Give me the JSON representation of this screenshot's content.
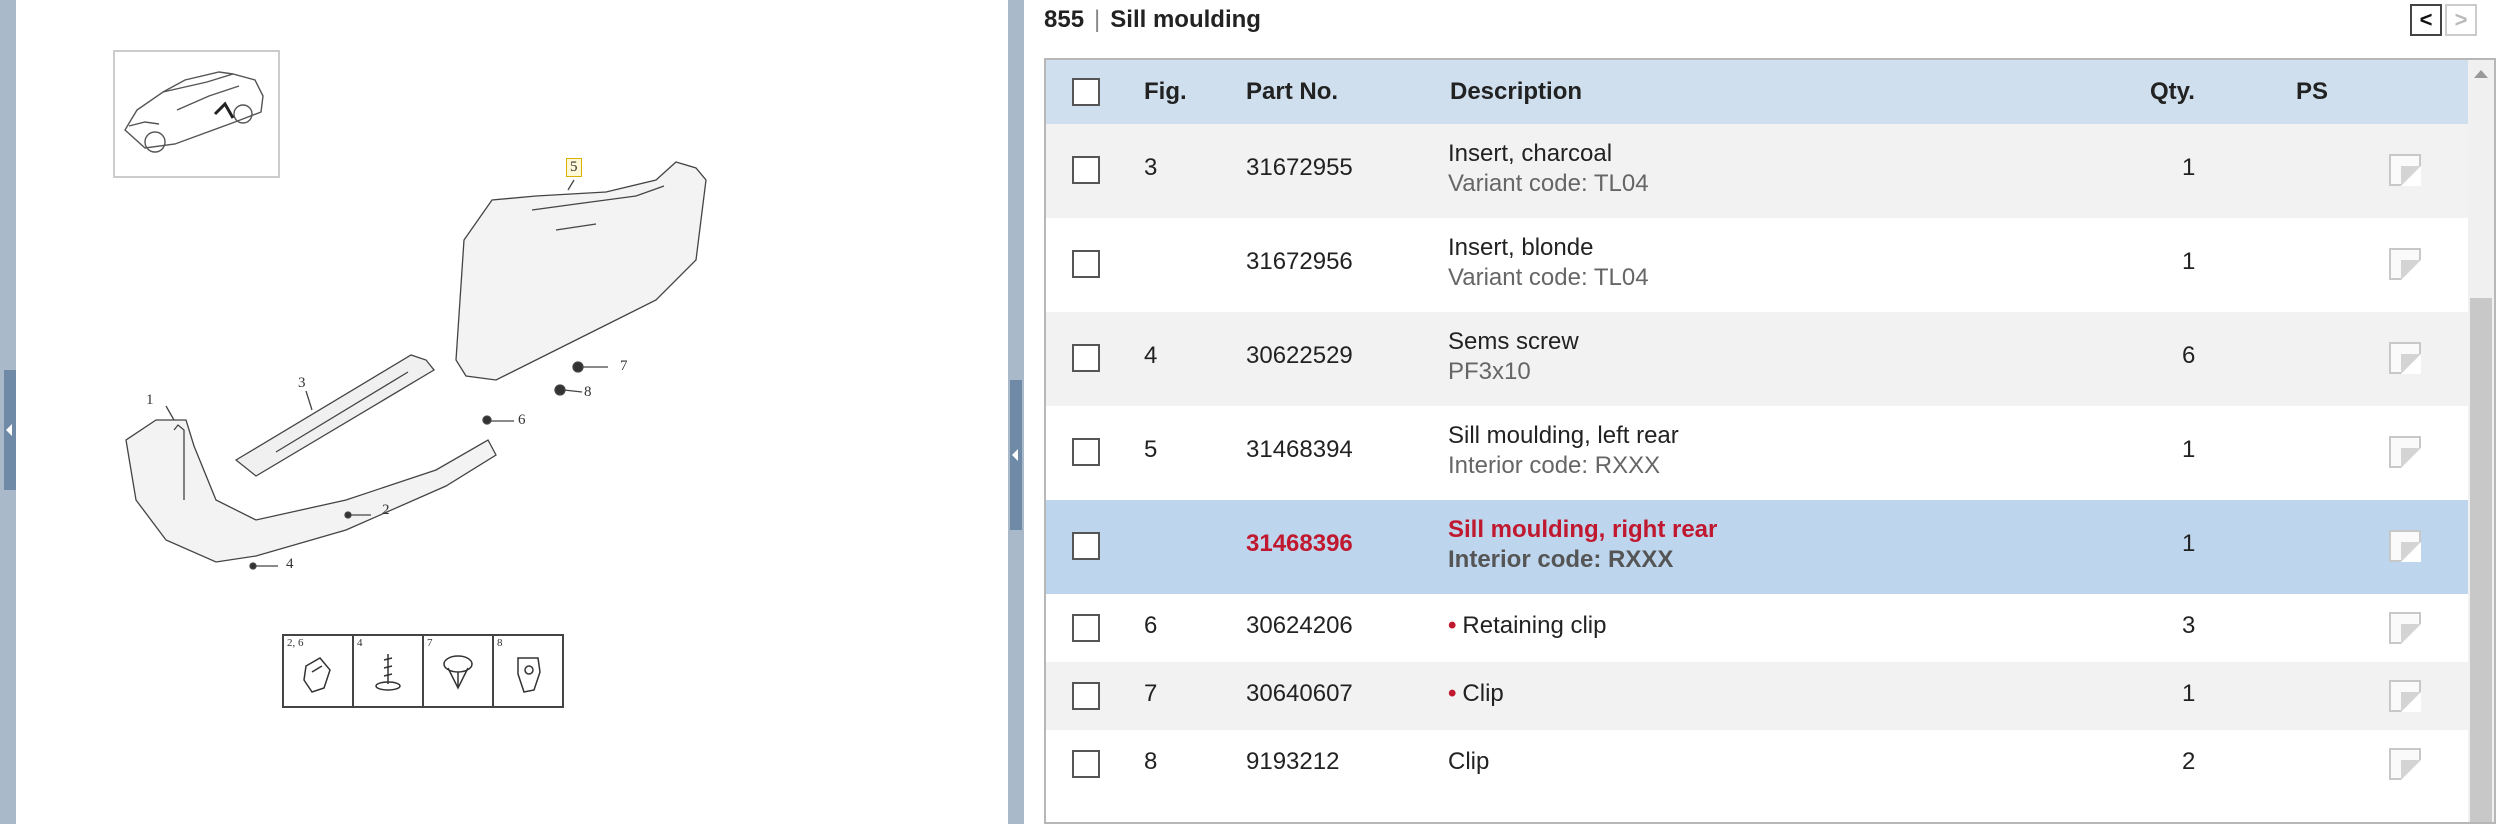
{
  "diagram": {
    "callouts": [
      "1",
      "2",
      "3",
      "4",
      "5",
      "6",
      "7",
      "8"
    ],
    "legend": [
      {
        "label": "2, 6"
      },
      {
        "label": "4"
      },
      {
        "label": "7"
      },
      {
        "label": "8"
      }
    ]
  },
  "header": {
    "group_number": "855",
    "separator": "|",
    "title": "Sill moulding"
  },
  "nav": {
    "prev_icon": "chevron-left-icon",
    "prev_glyph": "<",
    "next_icon": "chevron-right-icon",
    "next_glyph": ">"
  },
  "table": {
    "columns": {
      "fig": "Fig.",
      "part_no": "Part No.",
      "description": "Description",
      "qty": "Qty.",
      "ps": "PS"
    },
    "rows": [
      {
        "fig": "3",
        "part_no": "31672955",
        "description": "Insert, charcoal",
        "sub": "Variant code: TL04",
        "qty": "1",
        "bullet": ""
      },
      {
        "fig": "",
        "part_no": "31672956",
        "description": "Insert, blonde",
        "sub": "Variant code: TL04",
        "qty": "1",
        "bullet": ""
      },
      {
        "fig": "4",
        "part_no": "30622529",
        "description": "Sems screw",
        "sub": "PF3x10",
        "qty": "6",
        "bullet": ""
      },
      {
        "fig": "5",
        "part_no": "31468394",
        "description": "Sill moulding, left rear",
        "sub": "Interior code: RXXX",
        "qty": "1",
        "bullet": ""
      },
      {
        "fig": "",
        "part_no": "31468396",
        "description": "Sill moulding, right rear",
        "sub": "Interior code: RXXX",
        "qty": "1",
        "bullet": "",
        "selected": true
      },
      {
        "fig": "6",
        "part_no": "30624206",
        "description": "Retaining clip",
        "sub": "",
        "qty": "3",
        "bullet": "•"
      },
      {
        "fig": "7",
        "part_no": "30640607",
        "description": "Clip",
        "sub": "",
        "qty": "1",
        "bullet": "•"
      },
      {
        "fig": "8",
        "part_no": "9193212",
        "description": "Clip",
        "sub": "",
        "qty": "2",
        "bullet": ""
      }
    ]
  },
  "colors": {
    "header_bg": "#cfdfed",
    "selected_bg": "#bdd6ee",
    "selected_text": "#c0182e",
    "bullet": "#c0182e"
  }
}
